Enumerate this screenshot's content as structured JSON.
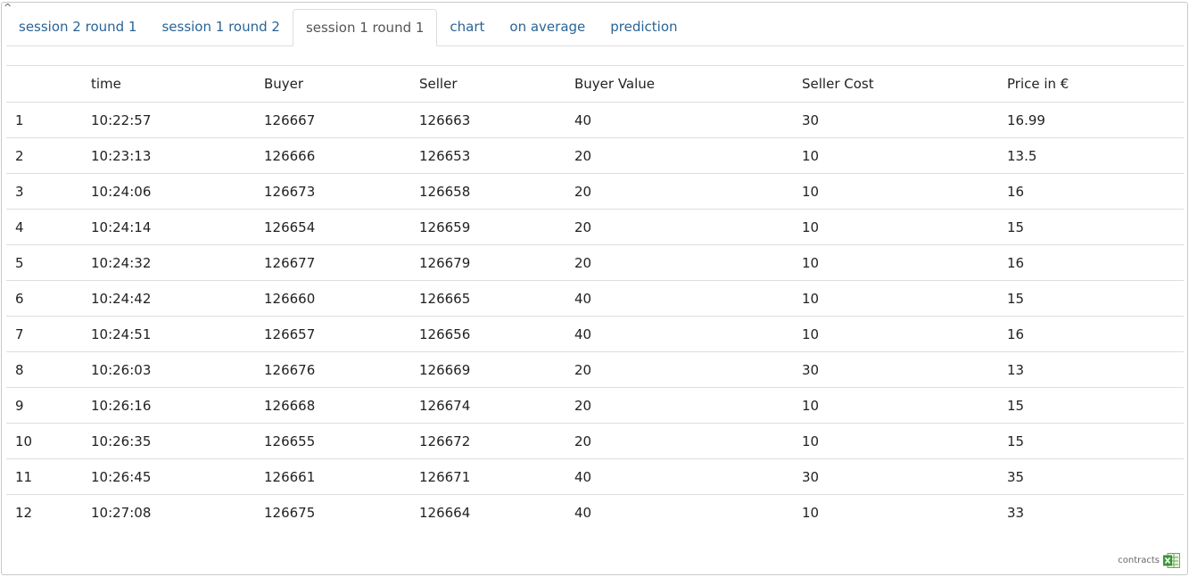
{
  "collapse_glyph": "^",
  "tabs": [
    {
      "label": "session 2 round 1",
      "active": false
    },
    {
      "label": "session 1 round 2",
      "active": false
    },
    {
      "label": "session 1 round 1",
      "active": true
    },
    {
      "label": "chart",
      "active": false
    },
    {
      "label": "on average",
      "active": false
    },
    {
      "label": "prediction",
      "active": false
    }
  ],
  "table": {
    "columns": [
      "",
      "time",
      "Buyer",
      "Seller",
      "Buyer Value",
      "Seller Cost",
      "Price in €"
    ],
    "rows": [
      [
        "1",
        "10:22:57",
        "126667",
        "126663",
        "40",
        "30",
        "16.99"
      ],
      [
        "2",
        "10:23:13",
        "126666",
        "126653",
        "20",
        "10",
        "13.5"
      ],
      [
        "3",
        "10:24:06",
        "126673",
        "126658",
        "20",
        "10",
        "16"
      ],
      [
        "4",
        "10:24:14",
        "126654",
        "126659",
        "20",
        "10",
        "15"
      ],
      [
        "5",
        "10:24:32",
        "126677",
        "126679",
        "20",
        "10",
        "16"
      ],
      [
        "6",
        "10:24:42",
        "126660",
        "126665",
        "40",
        "10",
        "15"
      ],
      [
        "7",
        "10:24:51",
        "126657",
        "126656",
        "40",
        "10",
        "16"
      ],
      [
        "8",
        "10:26:03",
        "126676",
        "126669",
        "20",
        "30",
        "13"
      ],
      [
        "9",
        "10:26:16",
        "126668",
        "126674",
        "20",
        "10",
        "15"
      ],
      [
        "10",
        "10:26:35",
        "126655",
        "126672",
        "20",
        "10",
        "15"
      ],
      [
        "11",
        "10:26:45",
        "126661",
        "126671",
        "40",
        "30",
        "35"
      ],
      [
        "12",
        "10:27:08",
        "126675",
        "126664",
        "40",
        "10",
        "33"
      ]
    ]
  },
  "footer": {
    "label": "contracts",
    "icon": "excel-export-icon"
  },
  "colors": {
    "tab_link": "#2a6496",
    "border": "#dddddd",
    "excel_green": "#3e9b3e"
  }
}
